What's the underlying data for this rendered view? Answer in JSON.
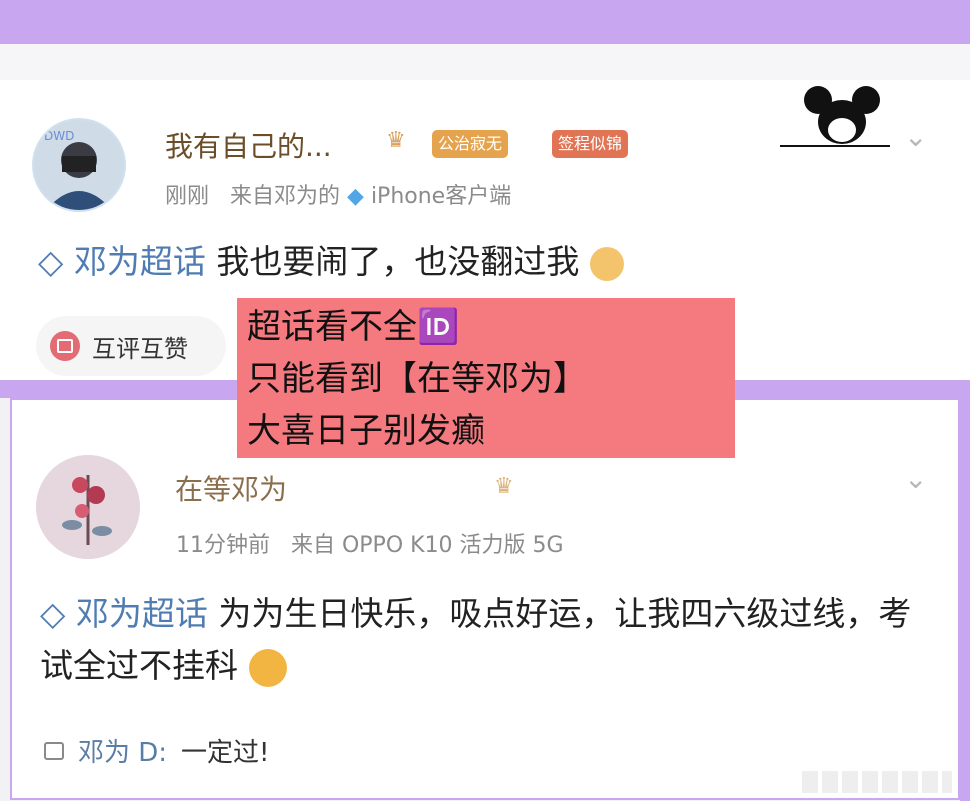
{
  "post1": {
    "username": "我有自己的...",
    "badge_fans": "公治寂无",
    "badge_sign": "签程似锦",
    "time": "刚刚",
    "source_prefix": "来自邓为的",
    "source_device": "iPhone客户端",
    "topic": "邓为超话",
    "text": "我也要闹了，也没翻过我",
    "mutual_button": "互评互赞"
  },
  "overlay": {
    "line1": "超话看不全🆔",
    "line2": "只能看到【在等邓为】",
    "line3": "大喜日子别发癫"
  },
  "post2": {
    "username": "在等邓为",
    "time": "11分钟前",
    "source": "来自 OPPO K10 活力版 5G",
    "topic": "邓为超话",
    "text": "为为生日快乐，吸点好运，让我四六级过线，考试全过不挂科",
    "comment_user": "邓为 D:",
    "comment_text": "一定过!"
  },
  "colors": {
    "accent_purple": "#c9a7f0",
    "topic_blue": "#4f7db3",
    "overlay_red": "#f57a80"
  }
}
